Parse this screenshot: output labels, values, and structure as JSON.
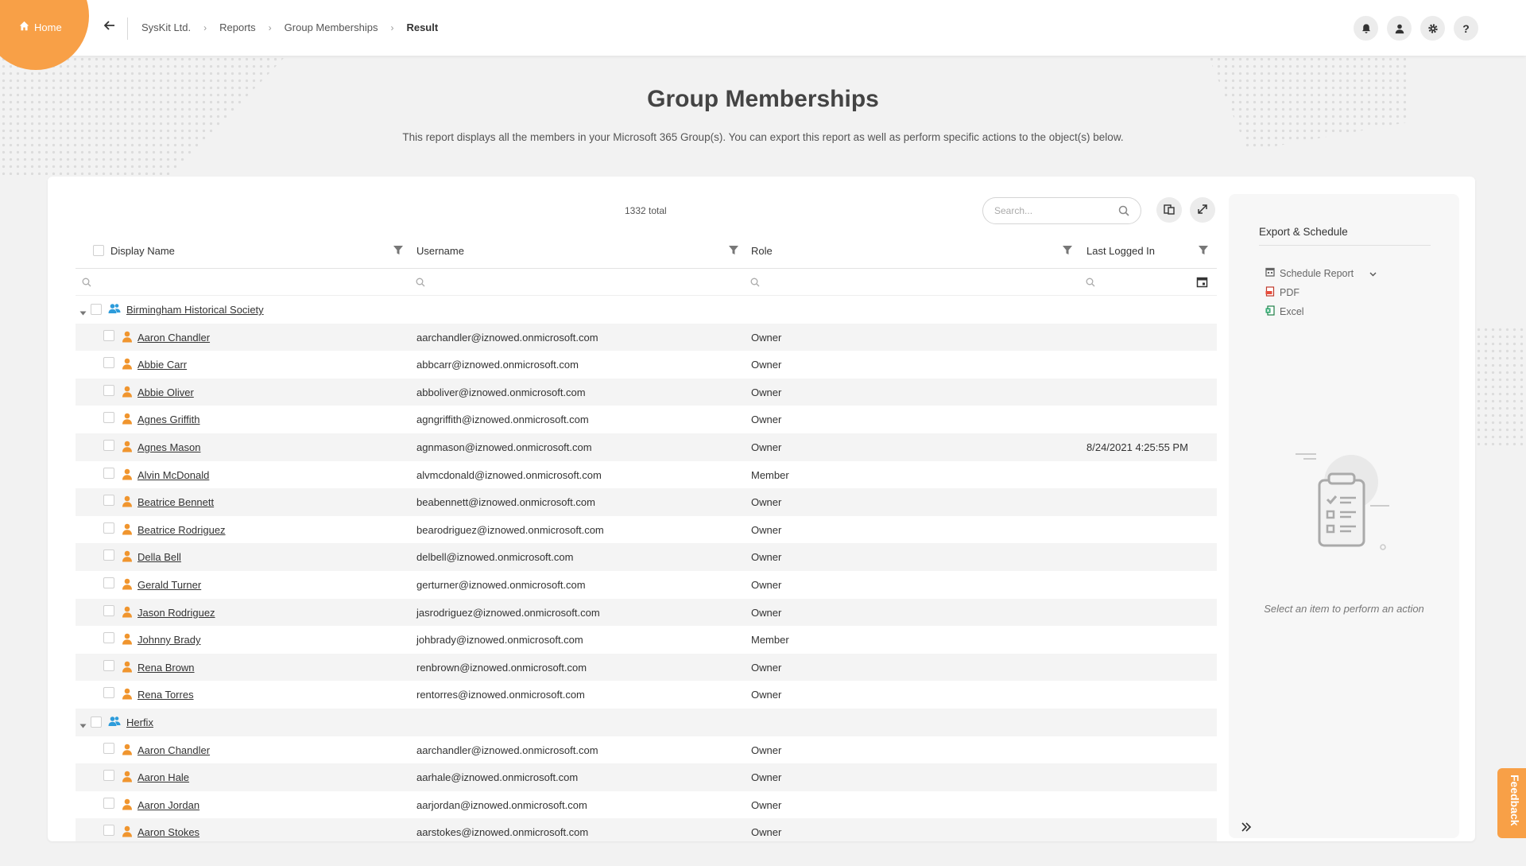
{
  "topbar": {
    "home_label": "Home",
    "breadcrumb": [
      "SysKit Ltd.",
      "Reports",
      "Group Memberships"
    ],
    "breadcrumb_current": "Result"
  },
  "page": {
    "title": "Group Memberships",
    "description": "This report displays all the members in your Microsoft 365 Group(s). You can export this report as well as perform specific actions to the object(s) below."
  },
  "toolbar": {
    "total": "1332 total",
    "search_placeholder": "Search..."
  },
  "table": {
    "columns": [
      "Display Name",
      "Username",
      "Role",
      "Last Logged In"
    ],
    "rows": [
      {
        "type": "group",
        "name": "Birmingham Historical Society"
      },
      {
        "type": "user",
        "name": "Aaron Chandler",
        "username": "aarchandler@iznowed.onmicrosoft.com",
        "role": "Owner",
        "last": ""
      },
      {
        "type": "user",
        "name": "Abbie Carr",
        "username": "abbcarr@iznowed.onmicrosoft.com",
        "role": "Owner",
        "last": ""
      },
      {
        "type": "user",
        "name": "Abbie Oliver",
        "username": "abboliver@iznowed.onmicrosoft.com",
        "role": "Owner",
        "last": ""
      },
      {
        "type": "user",
        "name": "Agnes Griffith",
        "username": "agngriffith@iznowed.onmicrosoft.com",
        "role": "Owner",
        "last": ""
      },
      {
        "type": "user",
        "name": "Agnes Mason",
        "username": "agnmason@iznowed.onmicrosoft.com",
        "role": "Owner",
        "last": "8/24/2021 4:25:55 PM"
      },
      {
        "type": "user",
        "name": "Alvin McDonald",
        "username": "alvmcdonald@iznowed.onmicrosoft.com",
        "role": "Member",
        "last": ""
      },
      {
        "type": "user",
        "name": "Beatrice Bennett",
        "username": "beabennett@iznowed.onmicrosoft.com",
        "role": "Owner",
        "last": ""
      },
      {
        "type": "user",
        "name": "Beatrice Rodriguez",
        "username": "bearodriguez@iznowed.onmicrosoft.com",
        "role": "Owner",
        "last": ""
      },
      {
        "type": "user",
        "name": "Della Bell",
        "username": "delbell@iznowed.onmicrosoft.com",
        "role": "Owner",
        "last": ""
      },
      {
        "type": "user",
        "name": "Gerald Turner",
        "username": "gerturner@iznowed.onmicrosoft.com",
        "role": "Owner",
        "last": ""
      },
      {
        "type": "user",
        "name": "Jason Rodriguez",
        "username": "jasrodriguez@iznowed.onmicrosoft.com",
        "role": "Owner",
        "last": ""
      },
      {
        "type": "user",
        "name": "Johnny Brady",
        "username": "johbrady@iznowed.onmicrosoft.com",
        "role": "Member",
        "last": ""
      },
      {
        "type": "user",
        "name": "Rena Brown",
        "username": "renbrown@iznowed.onmicrosoft.com",
        "role": "Owner",
        "last": ""
      },
      {
        "type": "user",
        "name": "Rena Torres",
        "username": "rentorres@iznowed.onmicrosoft.com",
        "role": "Owner",
        "last": ""
      },
      {
        "type": "group",
        "name": "Herfix"
      },
      {
        "type": "user",
        "name": "Aaron Chandler",
        "username": "aarchandler@iznowed.onmicrosoft.com",
        "role": "Owner",
        "last": ""
      },
      {
        "type": "user",
        "name": "Aaron Hale",
        "username": "aarhale@iznowed.onmicrosoft.com",
        "role": "Owner",
        "last": ""
      },
      {
        "type": "user",
        "name": "Aaron Jordan",
        "username": "aarjordan@iznowed.onmicrosoft.com",
        "role": "Owner",
        "last": ""
      },
      {
        "type": "user",
        "name": "Aaron Stokes",
        "username": "aarstokes@iznowed.onmicrosoft.com",
        "role": "Owner",
        "last": ""
      }
    ]
  },
  "panel": {
    "title": "Export & Schedule",
    "items": [
      "Schedule Report",
      "PDF",
      "Excel"
    ],
    "empty_message": "Select an item to perform an action"
  },
  "feedback_label": "Feedback",
  "colors": {
    "accent": "#f8a047",
    "group_icon": "#2d9cdb",
    "user_icon": "#f0952e"
  }
}
